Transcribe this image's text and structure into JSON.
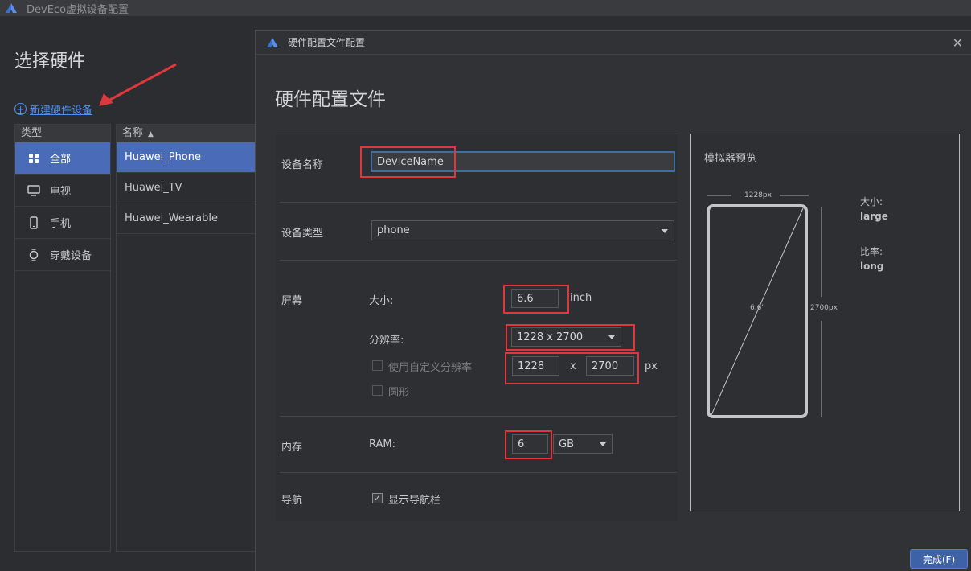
{
  "window": {
    "title": "DevEco虚拟设备配置"
  },
  "page": {
    "title": "选择硬件",
    "new_device_link": "新建硬件设备"
  },
  "type_list": {
    "header": "类型",
    "items": [
      {
        "label": "全部",
        "icon": "grid-icon",
        "selected": true
      },
      {
        "label": "电视",
        "icon": "tv-icon"
      },
      {
        "label": "手机",
        "icon": "phone-icon"
      },
      {
        "label": "穿戴设备",
        "icon": "watch-icon"
      }
    ]
  },
  "name_list": {
    "header": "名称",
    "sort_indicator": "▲",
    "items": [
      "Huawei_Phone",
      "Huawei_TV",
      "Huawei_Wearable"
    ]
  },
  "dialog": {
    "title": "硬件配置文件配置",
    "close": "✕",
    "heading": "硬件配置文件",
    "form": {
      "device_name_label": "设备名称",
      "device_name_value": "DeviceName",
      "device_type_label": "设备类型",
      "device_type_value": "phone",
      "screen_label": "屏幕",
      "size_label": "大小:",
      "size_value": "6.6",
      "size_unit": "inch",
      "resolution_label": "分辨率:",
      "resolution_value": "1228 x 2700",
      "custom_resolution_label": "使用自定义分辨率",
      "custom_width": "1228",
      "custom_x": "x",
      "custom_height": "2700",
      "custom_unit": "px",
      "round_label": "圆形",
      "memory_label": "内存",
      "ram_label": "RAM:",
      "ram_value": "6",
      "ram_unit": "GB",
      "nav_label": "导航",
      "show_nav_label": "显示导航栏",
      "show_nav_checked": true
    },
    "preview": {
      "title": "模拟器预览",
      "width_px": "1228px",
      "height_px": "2700px",
      "diagonal": "6.6\"",
      "size_label": "大小:",
      "size_value": "large",
      "ratio_label": "比率:",
      "ratio_value": "long"
    },
    "finish_button": "完成(F)"
  },
  "colors": {
    "accent": "#4a6bb8",
    "highlight": "#e0363c",
    "link": "#4e8ff0"
  }
}
